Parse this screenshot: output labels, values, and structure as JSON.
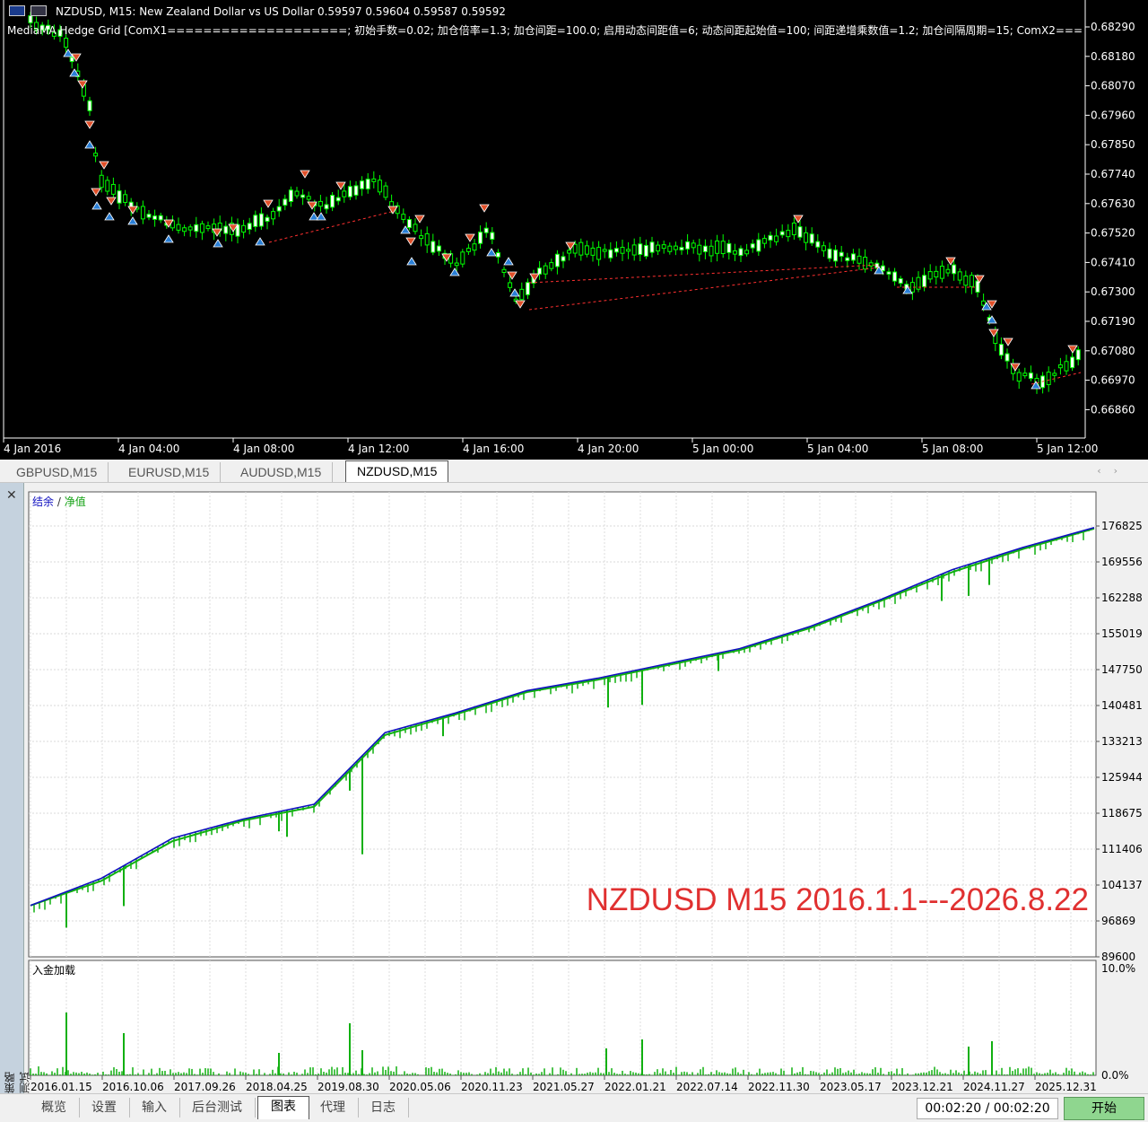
{
  "price_chart": {
    "title_symbol": "NZDUSD, M15:",
    "title_desc": "New Zealand Dollar vs US Dollar",
    "title_ohlc": "0.59597 0.59604 0.59587 0.59592",
    "ea_label": "MediaMA Hedge Grid [ComX1====================; 初始手数=0.02; 加仓倍率=1.3; 加仓间距=100.0; 启用动态间距值=6; 动态间距起始值=100; 间距递增乘数值=1.2; 加仓间隔周期=15; ComX2========",
    "price_ticks": [
      "0.68290",
      "0.68180",
      "0.68070",
      "0.67960",
      "0.67850",
      "0.67740",
      "0.67630",
      "0.67520",
      "0.67410",
      "0.67300",
      "0.67190",
      "0.67080",
      "0.66970",
      "0.66860"
    ],
    "time_ticks": [
      "4 Jan 2016",
      "4 Jan 04:00",
      "4 Jan 08:00",
      "4 Jan 12:00",
      "4 Jan 16:00",
      "4 Jan 20:00",
      "5 Jan 00:00",
      "5 Jan 04:00",
      "5 Jan 08:00",
      "5 Jan 12:00"
    ],
    "colors": {
      "background": "#000000",
      "candle_up": "#ffffff",
      "candle_outline": "#00ff00",
      "sell_arrow": "#e0502a",
      "buy_arrow": "#2a7fd6",
      "line": "#ff3030"
    }
  },
  "symbol_tabs": [
    {
      "label": "GBPUSD,M15"
    },
    {
      "label": "EURUSD,M15"
    },
    {
      "label": "AUDUSD,M15"
    },
    {
      "label": "NZDUSD,M15"
    }
  ],
  "tester": {
    "side_label": "策略测试",
    "legend_balance": "结余",
    "legend_sep": " / ",
    "legend_equity": "净值",
    "watermark": "NZDUSD M15 2016.1.1---2026.8.22",
    "deposit_label": "入金加载",
    "deposit_max": "10.0%",
    "deposit_min": "0.0%",
    "y_ticks": [
      "176825",
      "169556",
      "162288",
      "155019",
      "147750",
      "140481",
      "133213",
      "125944",
      "118675",
      "111406",
      "104137",
      "96869",
      "89600"
    ],
    "x_ticks": [
      "2016.01.15",
      "2016.10.06",
      "2017.09.26",
      "2018.04.25",
      "2019.08.30",
      "2020.05.06",
      "2020.11.23",
      "2021.05.27",
      "2022.01.21",
      "2022.07.14",
      "2022.11.30",
      "2023.05.17",
      "2023.12.21",
      "2024.11.27",
      "2025.12.31"
    ],
    "bottom_tabs": [
      {
        "label": "概览"
      },
      {
        "label": "设置"
      },
      {
        "label": "输入"
      },
      {
        "label": "后台测试"
      },
      {
        "label": "图表"
      },
      {
        "label": "代理"
      },
      {
        "label": "日志"
      }
    ],
    "time_display": "00:02:20 / 00:02:20",
    "start_button": "开始",
    "colors": {
      "balance": "#1010c0",
      "equity": "#10b010",
      "deposit": "#10b010",
      "watermark": "#e03030"
    }
  },
  "chart_data": [
    {
      "type": "line",
      "title": "",
      "xlabel": "",
      "ylabel": "",
      "series": [
        {
          "name": "结余",
          "values": [
            100000,
            105500,
            113600,
            117500,
            120500,
            135000,
            139000,
            143500,
            146000,
            149000,
            152000,
            156500,
            162000,
            168000,
            172500,
            176500
          ]
        },
        {
          "name": "净值",
          "values": [
            100000,
            105000,
            113000,
            117200,
            120000,
            134500,
            138700,
            143200,
            145700,
            148700,
            151700,
            156200,
            161700,
            167500,
            172200,
            176300
          ]
        }
      ],
      "x": [
        "2016.01.15",
        "2016.10.06",
        "2017.09.26",
        "2018.04.25",
        "2019.08.30",
        "2020.05.06",
        "2020.11.23",
        "2021.05.27",
        "2022.01.21",
        "2022.07.14",
        "2022.11.30",
        "2023.05.17",
        "2023.12.21",
        "2024.11.27",
        "2025.12.31",
        "2026.08.22"
      ],
      "ylim": [
        89600,
        180000
      ]
    }
  ]
}
